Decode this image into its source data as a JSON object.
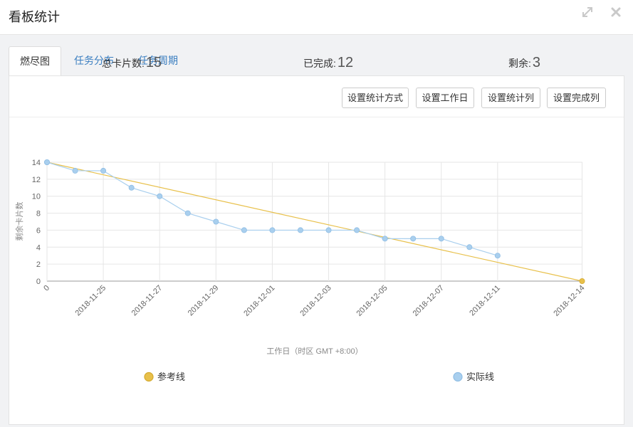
{
  "window": {
    "title": "看板统计",
    "buttons": [
      "expand-icon",
      "close-icon"
    ]
  },
  "tabs": [
    {
      "label": "燃尽图",
      "active": true
    },
    {
      "label": "任务分布",
      "active": false
    },
    {
      "label": "任务周期",
      "active": false
    }
  ],
  "toolbar": {
    "buttons": [
      "设置统计方式",
      "设置工作日",
      "设置统计列",
      "设置完成列"
    ]
  },
  "stats": {
    "total_label": "总卡片数:",
    "total_value": "15",
    "done_label": "已完成:",
    "done_value": "12",
    "remain_label": "剩余:",
    "remain_value": "3"
  },
  "colors": {
    "reference": "#e8c04a",
    "actual": "#a9cfee",
    "link": "#3a7ec0"
  },
  "chart_data": {
    "type": "line",
    "xlabel": "工作日（时区 GMT +8:00）",
    "ylabel": "剩余卡片数",
    "ylim": [
      0,
      14
    ],
    "yticks": [
      0,
      2,
      4,
      6,
      8,
      10,
      12,
      14
    ],
    "x_tick_labels": [
      "0",
      "2018-11-25",
      "2018-11-27",
      "2018-11-29",
      "2018-12-01",
      "2018-12-03",
      "2018-12-05",
      "2018-12-07",
      "2018-12-11",
      "2018-12-14"
    ],
    "x_tick_index": [
      0,
      2,
      4,
      6,
      8,
      10,
      12,
      14,
      16,
      19
    ],
    "x_count": 20,
    "grid": true,
    "series": [
      {
        "name": "参考线",
        "points": [
          [
            0,
            14
          ],
          [
            19,
            0
          ]
        ]
      },
      {
        "name": "实际线",
        "points": [
          [
            0,
            14
          ],
          [
            1,
            13
          ],
          [
            2,
            13
          ],
          [
            3,
            11
          ],
          [
            4,
            10
          ],
          [
            5,
            8
          ],
          [
            6,
            7
          ],
          [
            7,
            6
          ],
          [
            8,
            6
          ],
          [
            9,
            6
          ],
          [
            10,
            6
          ],
          [
            11,
            6
          ],
          [
            12,
            5
          ],
          [
            13,
            5
          ],
          [
            14,
            5
          ],
          [
            15,
            4
          ],
          [
            16,
            3
          ]
        ]
      }
    ],
    "legend": [
      "参考线",
      "实际线"
    ]
  }
}
